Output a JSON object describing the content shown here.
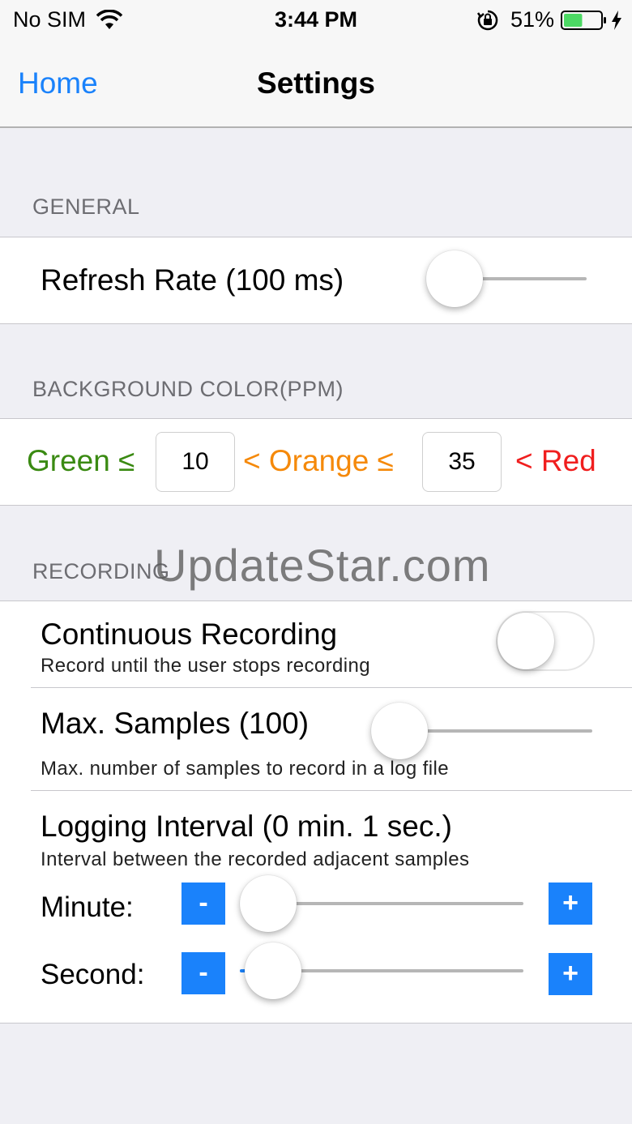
{
  "status_bar": {
    "carrier": "No SIM",
    "time": "3:44 PM",
    "battery_percent": "51%",
    "battery_level": 0.51,
    "battery_color": "#4cd964",
    "icons": [
      "wifi-icon",
      "rotation-lock-icon",
      "battery-icon",
      "charging-bolt-icon"
    ]
  },
  "nav": {
    "back_label": "Home",
    "title": "Settings",
    "tint_color": "#1a82fb"
  },
  "general": {
    "header": "GENERAL",
    "refresh_rate": {
      "label": "Refresh Rate (100 ms)",
      "slider_level": 0.0
    }
  },
  "background_color": {
    "header": "BACKGROUND COLOR(PPM)",
    "green_label": "Green ≤",
    "green_color": "#3a8a12",
    "green_threshold": "10",
    "orange_label": "< Orange ≤",
    "orange_color": "#f5890a",
    "orange_threshold": "35",
    "red_label": "< Red",
    "red_color": "#f01e1e"
  },
  "recording": {
    "header": "RECORDING",
    "continuous": {
      "label": "Continuous Recording",
      "sublabel": "Record until the user stops recording",
      "enabled": false
    },
    "max_samples": {
      "label": "Max. Samples (100)",
      "sublabel": "Max. number of samples to record in a log file",
      "slider_level": 0.0
    },
    "logging_interval": {
      "label": "Logging Interval (0 min. 1 sec.)",
      "sublabel": "Interval between the recorded adjacent samples",
      "minute_label": "Minute:",
      "minute_level": 0.0,
      "second_label": "Second:",
      "second_level": 0.02,
      "minus_label": "-",
      "plus_label": "+"
    }
  },
  "watermark": "UpdateStar.com"
}
